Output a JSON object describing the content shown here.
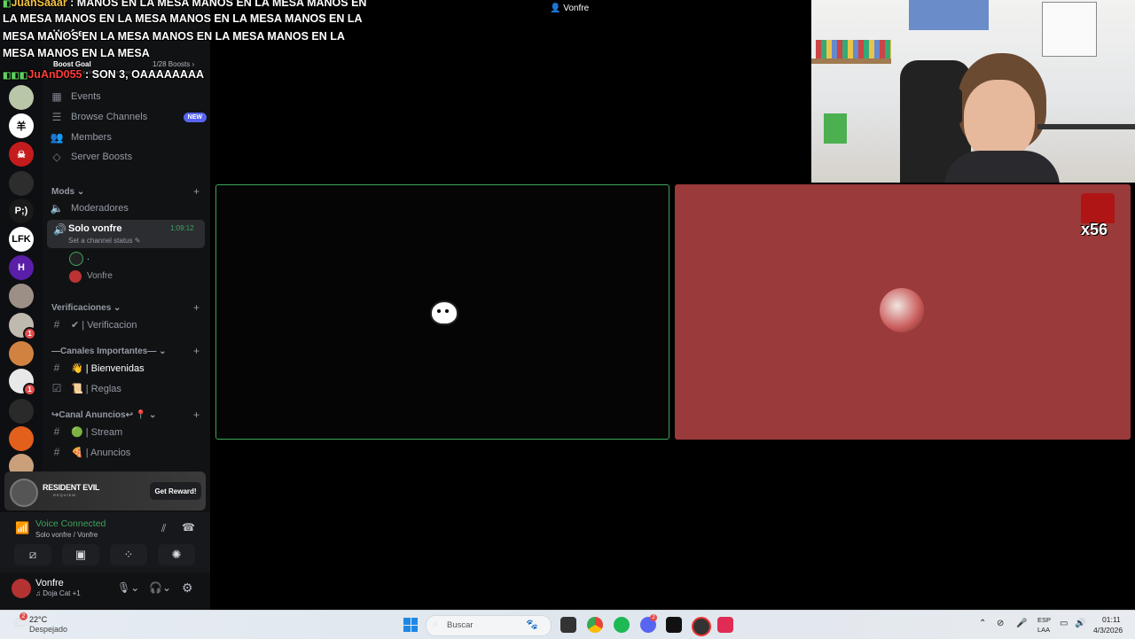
{
  "chat": {
    "line1": {
      "user": "JuanSaaar",
      "text": ": MANOS EN LA MESA  MANOS EN LA MESA  MANOS EN"
    },
    "line2": "LA MESA  MANOS EN LA MESA  MANOS EN LA MESA  MANOS EN LA",
    "line3": "MESA  MANOS EN LA MESA  MANOS EN LA MESA  MANOS EN LA",
    "line4": "MESA  MANOS EN LA MESA",
    "line5": {
      "user": "JuAnD055",
      "text": ": SON 3, OAAAAAAAA"
    }
  },
  "top_bar": {
    "user_label": "Vonfre"
  },
  "server": {
    "partial_name": "Vonfre",
    "boost_goal_label": "Boost Goal",
    "boost_count": "1/28 Boosts"
  },
  "sidebar": {
    "items": [
      {
        "label": "Events",
        "icon": "calendar-icon"
      },
      {
        "label": "Browse Channels",
        "icon": "browse-icon",
        "badge": "NEW"
      },
      {
        "label": "Members",
        "icon": "members-icon"
      },
      {
        "label": "Server Boosts",
        "icon": "boost-icon"
      }
    ],
    "categories": {
      "mods": "Mods",
      "verificaciones": "Verificaciones",
      "canales": "—Canales Importantes—",
      "anuncios": "↪Canal Anuncios↩ 📍"
    },
    "channels": {
      "moderadores": "Moderadores",
      "solo_vonfre": "Solo vonfre",
      "solo_vonfre_time": "1:09:12",
      "solo_vonfre_status": "Set a channel status",
      "voice_user1": ".",
      "voice_user2": "Vonfre",
      "verificacion": "✔ | Verificacion",
      "bienvenidas": "👋 | Bienvenidas",
      "reglas": "📜 | Reglas",
      "stream": "🟢 | Stream",
      "anuncios": "🍕 | Anuncios"
    }
  },
  "promo": {
    "game_title": "RESIDENT EVIL",
    "game_subtitle": "REQUIEM",
    "button": "Get Reward!"
  },
  "voice": {
    "status": "Voice Connected",
    "location": "Solo vonfre / Vonfre"
  },
  "user": {
    "name": "Vonfre",
    "activity": "Doja Cat +1"
  },
  "stream_overlay": {
    "multiplier": "x56"
  },
  "taskbar": {
    "weather_temp": "22°C",
    "weather_desc": "Despejado",
    "weather_badge": "2",
    "search_placeholder": "Buscar",
    "lang_top": "ESP",
    "lang_bottom": "LAA",
    "time": "01:11",
    "date": "4/3/2026",
    "discord_badge": "2"
  },
  "colors": {
    "accent_green": "#3ba55c",
    "tile_red": "#9b3a3a",
    "badge_blue": "#5865f2",
    "notif_red": "#e34c4c"
  }
}
